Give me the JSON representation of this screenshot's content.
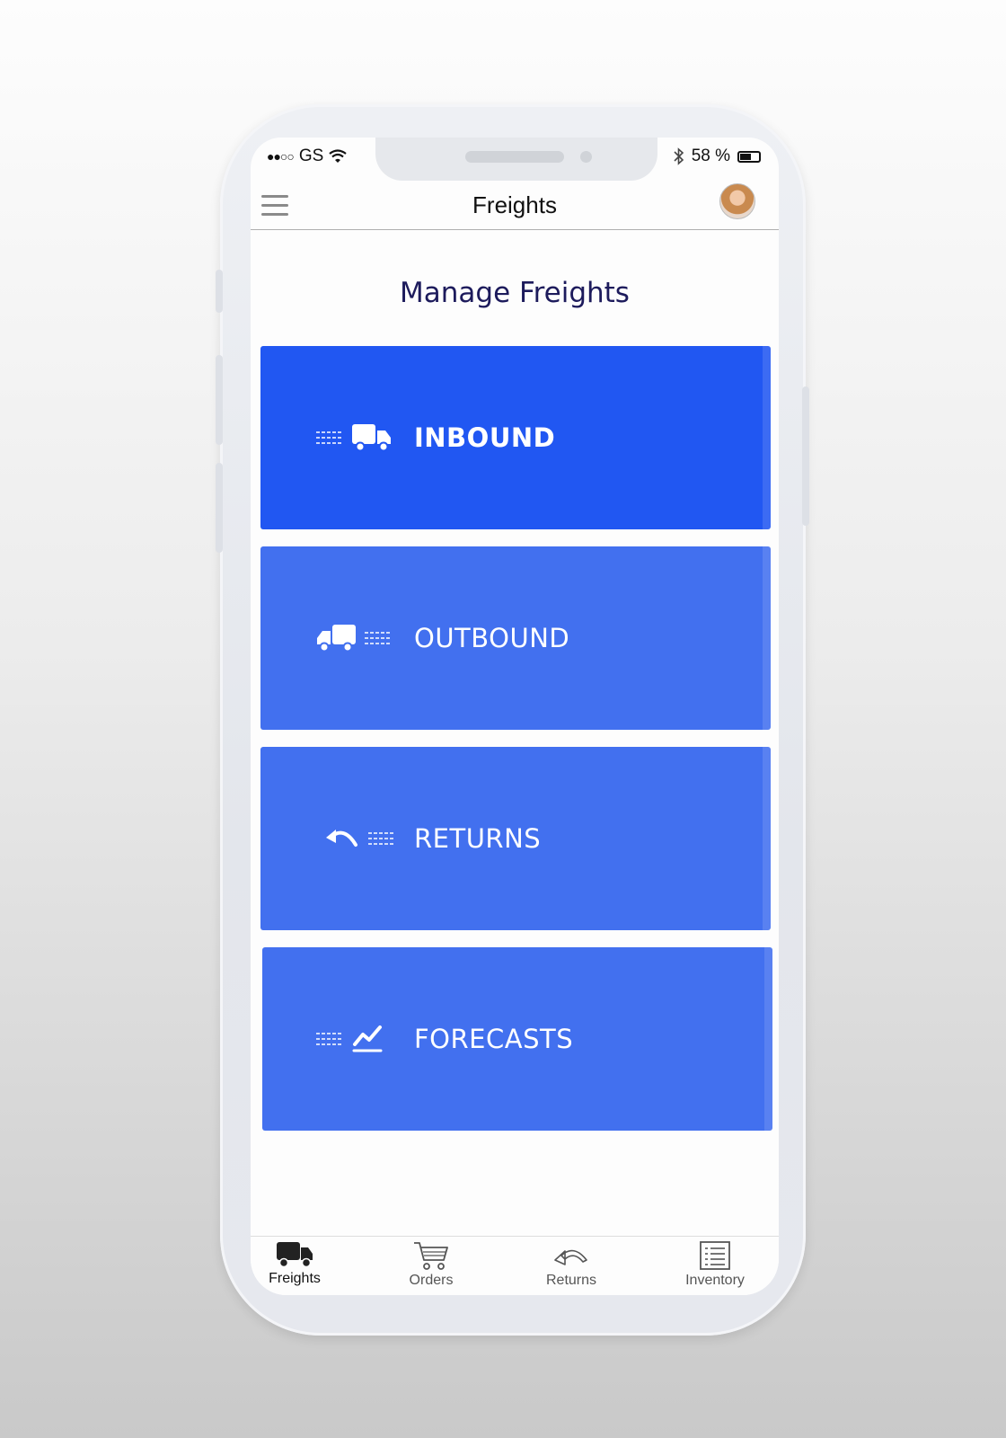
{
  "status_bar": {
    "carrier": "GS",
    "signal_glyphs": "●●○○",
    "battery_percent": "58 %",
    "battery_level": 0.58
  },
  "navbar": {
    "title": "Freights",
    "menu_icon": "hamburger-icon",
    "avatar_icon": "user-avatar"
  },
  "main": {
    "title": "Manage Freights",
    "tiles": [
      {
        "label": "INBOUND",
        "icons": [
          "speed-lines-icon",
          "truck-icon"
        ],
        "selected": true
      },
      {
        "label": "OUTBOUND",
        "icons": [
          "truck-icon",
          "speed-lines-icon"
        ],
        "selected": false
      },
      {
        "label": "RETURNS",
        "icons": [
          "undo-arrow-icon",
          "speed-lines-icon"
        ],
        "selected": false
      },
      {
        "label": "FORECASTS",
        "icons": [
          "speed-lines-icon",
          "trend-chart-icon"
        ],
        "selected": false
      }
    ]
  },
  "tabbar": {
    "items": [
      {
        "label": "Freights",
        "icon": "truck-icon",
        "selected": true
      },
      {
        "label": "Orders",
        "icon": "cart-icon",
        "selected": false
      },
      {
        "label": "Returns",
        "icon": "return-arrow-icon",
        "selected": false
      },
      {
        "label": "Inventory",
        "icon": "list-icon",
        "selected": false
      }
    ]
  },
  "colors": {
    "tile_selected": "#2157f2",
    "tile": "#4270ef",
    "title_text": "#1d1b5c"
  }
}
